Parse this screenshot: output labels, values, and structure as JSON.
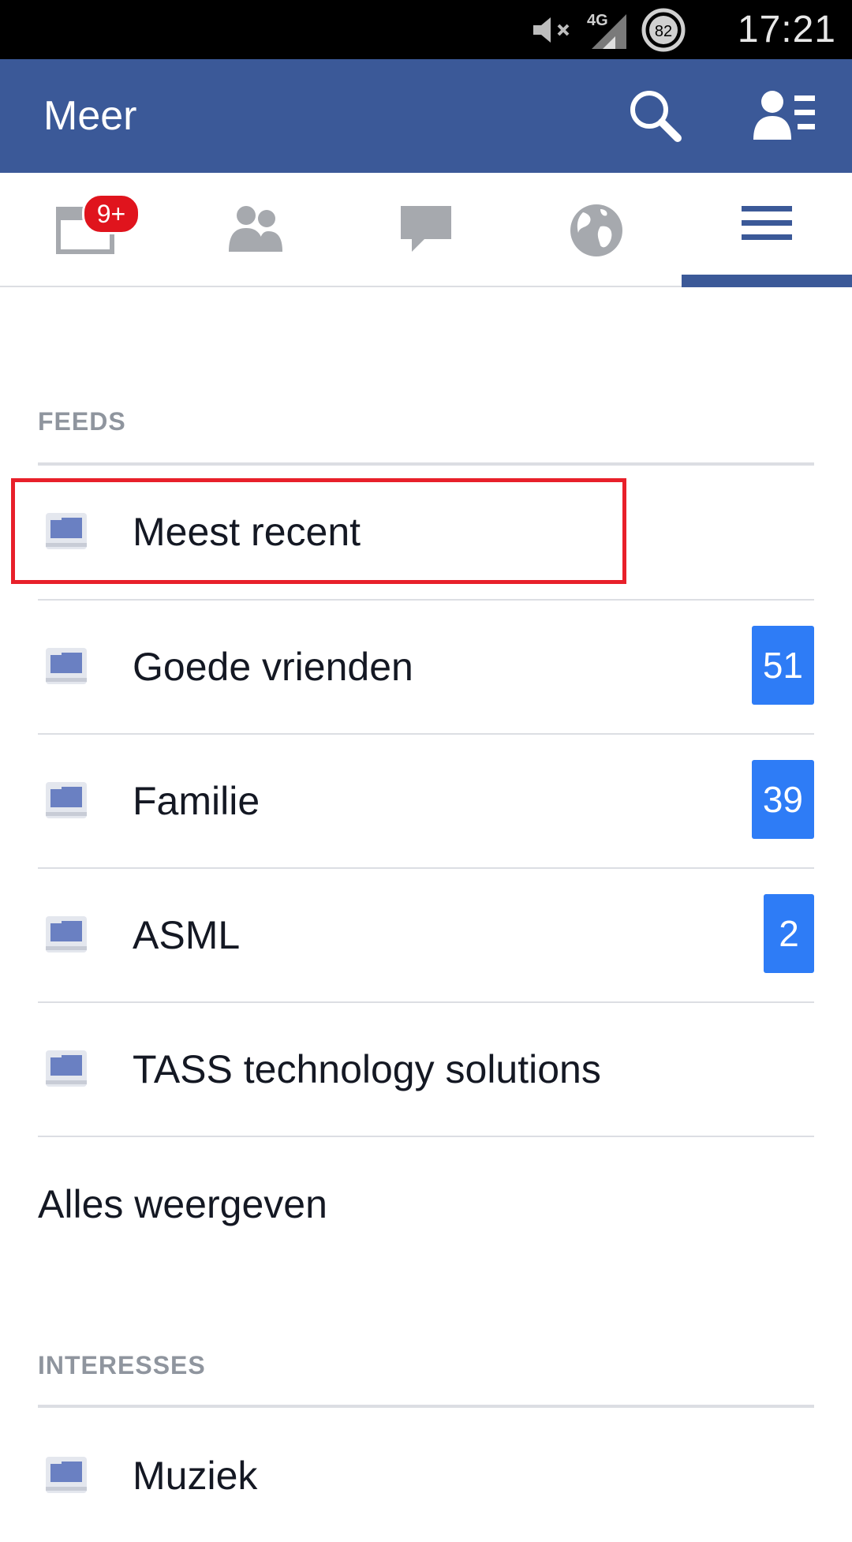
{
  "status_bar": {
    "time": "17:21",
    "battery_level": "82",
    "network": "4G",
    "icons": [
      "mute-icon",
      "signal-icon",
      "battery-icon"
    ]
  },
  "app_bar": {
    "title": "Meer",
    "icons": [
      "search-icon",
      "friend-requests-icon"
    ],
    "color": "#3b5998"
  },
  "tabs": {
    "items": [
      {
        "name": "news-feed",
        "icon": "news-feed-icon",
        "badge": "9+"
      },
      {
        "name": "friends",
        "icon": "friends-icon"
      },
      {
        "name": "messages",
        "icon": "chat-bubble-icon"
      },
      {
        "name": "notifications",
        "icon": "globe-icon"
      },
      {
        "name": "more",
        "icon": "menu-icon",
        "active": true
      }
    ]
  },
  "feeds": {
    "header": "FEEDS",
    "items": [
      {
        "label": "Meest recent",
        "count": null
      },
      {
        "label": "Goede vrienden",
        "count": "51"
      },
      {
        "label": "Familie",
        "count": "39"
      },
      {
        "label": "ASML",
        "count": "2"
      },
      {
        "label": "TASS technology solutions",
        "count": null
      }
    ],
    "show_all": "Alles weergeven"
  },
  "interests": {
    "header": "INTERESSES",
    "items": [
      {
        "label": "Muziek"
      }
    ]
  },
  "colors": {
    "badge_blue": "#2e7cf6",
    "badge_red": "#e0141d",
    "highlight": "#e8202a"
  }
}
